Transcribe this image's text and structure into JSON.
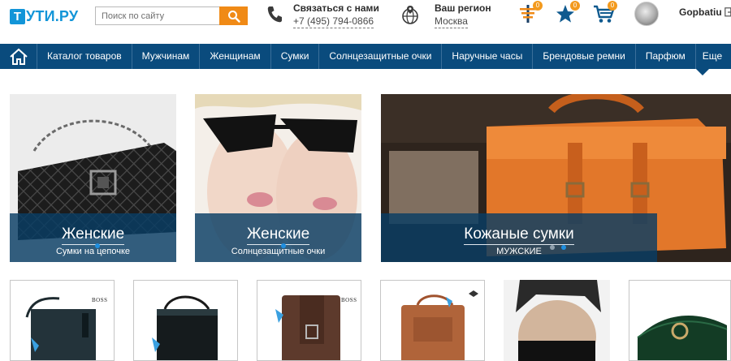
{
  "header": {
    "logo": {
      "box_letter": "Т",
      "text": "УТИ.РУ"
    },
    "search": {
      "placeholder": "Поиск по сайту"
    },
    "contact": {
      "label": "Связаться с нами",
      "phone": "+7 (495) 794-0866"
    },
    "region": {
      "label": "Ваш регион",
      "value": "Москва"
    },
    "icons": [
      {
        "name": "compare-icon",
        "badge": "0"
      },
      {
        "name": "favorites-star-icon",
        "badge": "0"
      },
      {
        "name": "cart-icon",
        "badge": "0"
      }
    ],
    "user": {
      "name": "Gopbatiu"
    }
  },
  "nav": {
    "items": [
      "Каталог товаров",
      "Мужчинам",
      "Женщинам",
      "Сумки",
      "Солнцезащитные очки",
      "Наручные часы",
      "Брендовые ремни",
      "Парфюм",
      "Еще"
    ]
  },
  "banners": [
    {
      "title": "Женские",
      "subtitle": "Сумки на цепочке"
    },
    {
      "title": "Женские",
      "subtitle": "Солнцезащитные очки"
    },
    {
      "title": "Кожаные сумки",
      "subtitle": "МУЖСКИЕ"
    }
  ],
  "products": [
    {
      "brand": "BOSS"
    },
    {
      "brand": ""
    },
    {
      "brand": "BOSS"
    },
    {
      "brand": ""
    },
    {
      "brand": ""
    },
    {
      "brand": ""
    }
  ],
  "colors": {
    "brand_blue": "#1295d8",
    "nav_blue": "#0a4b7d",
    "accent_orange": "#f08a16"
  }
}
